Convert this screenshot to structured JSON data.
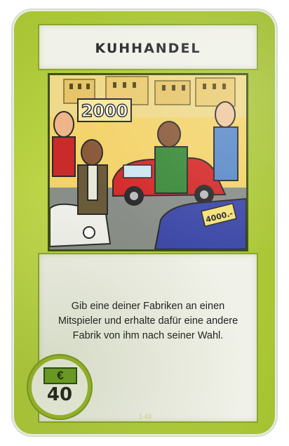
{
  "card": {
    "title": "KUHHANDEL",
    "rule_text": "Gib eine deiner Fabriken an einen Mitspieler und erhalte dafür eine andere Fabrik von ihm nach seiner Wahl.",
    "cost": {
      "currency_symbol": "€",
      "value": "40"
    },
    "code": "1-43"
  },
  "illustration": {
    "sign_left": "2000",
    "sign_right": "4000.-",
    "icon": "cartoon-car-trade-icon"
  },
  "colors": {
    "card_green": "#b4cf3f",
    "panel_bg": "#f0f1e8",
    "euro_green": "#6ea32a"
  }
}
